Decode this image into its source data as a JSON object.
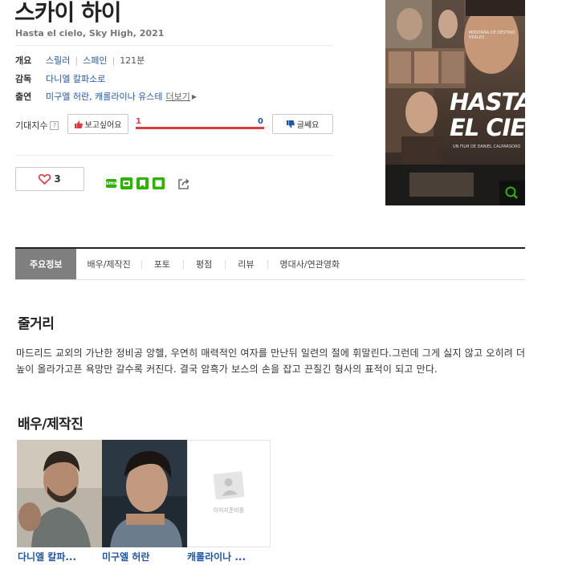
{
  "movie": {
    "title": "스카이 하이",
    "subtitle": "Hasta el cielo, Sky High, 2021"
  },
  "info": {
    "overview_label": "개요",
    "genre": "스릴러",
    "country": "스페인",
    "runtime": "121분",
    "director_label": "감독",
    "director": "다니엘 칼파소로",
    "cast_label": "출연",
    "cast_list": "미구엘 허란, 캐롤라이나 유스테",
    "more_label": "더보기"
  },
  "expectation": {
    "label": "기대지수",
    "help_icon": "?",
    "want_label": "보고싶어요",
    "want_count": "1",
    "dislike_count": "0",
    "dislike_label": "글쎄요",
    "want_fraction": 1.0
  },
  "actions": {
    "like_count": "3"
  },
  "poster": {
    "small_top": "MONTAÑA DE DESTINO REALES",
    "line1": "HASTA",
    "line2": "EL CIELO",
    "credit": "UN FILM DE DANIEL CALPARSORO"
  },
  "tabs": [
    "주요정보",
    "배우/제작진",
    "포토",
    "평점",
    "리뷰",
    "명대사/연관영화"
  ],
  "synopsis": {
    "heading": "줄거리",
    "text": "마드리드 교외의 가난한 정비공 앙헬, 우연히 매력적인 여자를 만난뒤 일련의 절에 휘말린다.그런데 그게 싫지 않고 오히려 더 높이 올라가고픈 욕망만 갈수록 커진다. 결국 암흑가 보스의 손을 잡고 끈질긴 형사의 표적이 되고 만다."
  },
  "cast_section": {
    "heading": "배우/제작진",
    "placeholder_text": "이미지준비중",
    "members": [
      "다니엘 칼파...",
      "미구엘 허란",
      "캐롤라이나 ..."
    ]
  },
  "colors": {
    "link": "#2157a8",
    "want_bar": "#e0393e",
    "active_tab": "#7f7f7f"
  }
}
